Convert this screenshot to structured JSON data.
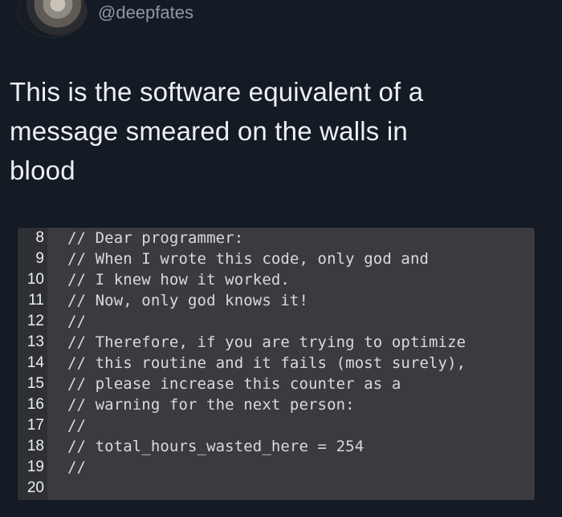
{
  "header": {
    "username": "@deepfates"
  },
  "tweet": {
    "line_1": "This is the software equivalent of a",
    "line_2": "message smeared on the walls in",
    "line_3": "blood"
  },
  "code": {
    "lines": [
      {
        "number": "8",
        "text": "// Dear programmer:"
      },
      {
        "number": "9",
        "text": "// When I wrote this code, only god and"
      },
      {
        "number": "10",
        "text": "// I knew how it worked."
      },
      {
        "number": "11",
        "text": "// Now, only god knows it!"
      },
      {
        "number": "12",
        "text": "//"
      },
      {
        "number": "13",
        "text": "// Therefore, if you are trying to optimize"
      },
      {
        "number": "14",
        "text": "// this routine and it fails (most surely),"
      },
      {
        "number": "15",
        "text": "// please increase this counter as a"
      },
      {
        "number": "16",
        "text": "// warning for the next person:"
      },
      {
        "number": "17",
        "text": "//"
      },
      {
        "number": "18",
        "text": "// total_hours_wasted_here = 254"
      },
      {
        "number": "19",
        "text": "//"
      },
      {
        "number": "20",
        "text": ""
      }
    ]
  }
}
